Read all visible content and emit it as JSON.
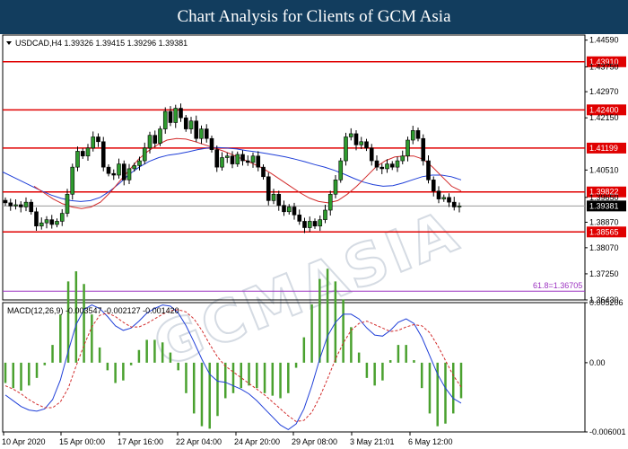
{
  "header": {
    "title": "Chart Analysis for Clients of GCM Asia"
  },
  "chart_data": {
    "type": "candlestick",
    "symbol_line": "USDCAD,H4  1.39326 1.39415 1.39296 1.39381",
    "price_axis": {
      "min": 1.3643,
      "max": 1.4475,
      "ticks": [
        "1.44590",
        "1.43750",
        "1.42970",
        "1.42150",
        "1.40510",
        "1.39650",
        "1.38870",
        "1.38070",
        "1.37250",
        "1.36430"
      ]
    },
    "time_axis": {
      "ticks": [
        "10 Apr 2020",
        "15 Apr 00:00",
        "17 Apr 16:00",
        "22 Apr 04:00",
        "24 Apr 20:00",
        "29 Apr 08:00",
        "3 May 21:01",
        "6 May 12:00"
      ]
    },
    "horizontal_levels": [
      {
        "label": "1.43910",
        "value": 1.4391,
        "color": "#e00000"
      },
      {
        "label": "1.42400",
        "value": 1.424,
        "color": "#e00000"
      },
      {
        "label": "1.41199",
        "value": 1.41199,
        "color": "#e00000"
      },
      {
        "label": "1.39822",
        "value": 1.39822,
        "color": "#e00000"
      },
      {
        "label": "1.38565",
        "value": 1.38565,
        "color": "#e00000"
      }
    ],
    "current_price": {
      "label": "1.39381",
      "value": 1.39381
    },
    "fib_level": {
      "text": "61.8=1.36705",
      "value": 1.36705,
      "color": "#9b30c0"
    },
    "closes": [
      1.3948,
      1.3938,
      1.3942,
      1.3935,
      1.395,
      1.392,
      1.3875,
      1.3885,
      1.3895,
      1.388,
      1.389,
      1.3915,
      1.3975,
      1.406,
      1.411,
      1.4095,
      1.412,
      1.4155,
      1.414,
      1.406,
      1.404,
      1.4035,
      1.407,
      1.402,
      1.4055,
      1.4065,
      1.408,
      1.412,
      1.416,
      1.4135,
      1.418,
      1.4235,
      1.42,
      1.4245,
      1.4215,
      1.418,
      1.4205,
      1.415,
      1.418,
      1.415,
      1.4115,
      1.406,
      1.409,
      1.4095,
      1.407,
      1.41,
      1.408,
      1.4075,
      1.4095,
      1.406,
      1.403,
      1.3955,
      1.3975,
      1.394,
      1.392,
      1.3935,
      1.391,
      1.389,
      1.387,
      1.389,
      1.3875,
      1.3895,
      1.3925,
      1.3975,
      1.402,
      1.408,
      1.4155,
      1.4165,
      1.413,
      1.414,
      1.412,
      1.408,
      1.406,
      1.4055,
      1.407,
      1.406,
      1.408,
      1.4095,
      1.4145,
      1.4175,
      1.415,
      1.408,
      1.402,
      1.3985,
      1.396,
      1.3965,
      1.395,
      1.3935,
      1.3938
    ],
    "ma_blue": [
      1.4045,
      1.403,
      1.4015,
      1.4,
      1.3985,
      1.3972,
      1.3962,
      1.3955,
      1.3952,
      1.3955,
      1.3965,
      1.3985,
      1.401,
      1.4038,
      1.406,
      1.4078,
      1.409,
      1.4098,
      1.4102,
      1.4108,
      1.4115,
      1.412,
      1.4122,
      1.412,
      1.4117,
      1.4112,
      1.4108,
      1.4103,
      1.4098,
      1.4092,
      1.4085,
      1.4077,
      1.4068,
      1.406,
      1.405,
      1.4038,
      1.4025,
      1.4013,
      1.4005,
      1.4,
      1.4002,
      1.401,
      1.402,
      1.403,
      1.4035,
      1.4035,
      1.403,
      1.402
    ],
    "ma_red": [
      1.4,
      1.398,
      1.396,
      1.3945,
      1.3935,
      1.393,
      1.3935,
      1.395,
      1.398,
      1.4015,
      1.405,
      1.4085,
      1.411,
      1.413,
      1.4145,
      1.415,
      1.4148,
      1.414,
      1.413,
      1.412,
      1.411,
      1.4098,
      1.4085,
      1.4072,
      1.4058,
      1.404,
      1.402,
      1.4,
      1.398,
      1.3963,
      1.3952,
      1.3948,
      1.3955,
      1.3975,
      1.4,
      1.403,
      1.406,
      1.408,
      1.4092,
      1.4095,
      1.4095,
      1.4085,
      1.406,
      1.403,
      1.4,
      1.3985
    ],
    "macd": {
      "label": "MACD(12,26,9) -0.003547 -0.002127 -0.001420",
      "axis": {
        "min": -0.006001,
        "max": 0.005206,
        "ticks": [
          "0.005206",
          "0.00",
          "-0.006001"
        ]
      },
      "macd_line": [
        -0.0028,
        -0.0033,
        -0.0038,
        -0.0041,
        -0.0042,
        -0.004,
        -0.0032,
        -0.0015,
        0.001,
        0.0033,
        0.0046,
        0.005,
        0.0047,
        0.004,
        0.0032,
        0.0028,
        0.003,
        0.0036,
        0.0043,
        0.0047,
        0.005,
        0.0049,
        0.0043,
        0.0032,
        0.0018,
        0.0003,
        -0.001,
        -0.0016,
        -0.0017,
        -0.002,
        -0.0023,
        -0.0027,
        -0.0033,
        -0.004,
        -0.0047,
        -0.0054,
        -0.0058,
        -0.0053,
        -0.004,
        -0.002,
        0.0003,
        0.0023,
        0.0035,
        0.0042,
        0.0042,
        0.0038,
        0.003,
        0.0024,
        0.0023,
        0.0028,
        0.0035,
        0.0038,
        0.0034,
        0.0022,
        0.0006,
        -0.001,
        -0.0022,
        -0.0031,
        -0.0035
      ],
      "signal_line": [
        -0.002,
        -0.0023,
        -0.0027,
        -0.0032,
        -0.0036,
        -0.0039,
        -0.0039,
        -0.0034,
        -0.0022,
        -0.0003,
        0.0015,
        0.0031,
        0.0041,
        0.0043,
        0.004,
        0.0035,
        0.0031,
        0.0031,
        0.0034,
        0.0038,
        0.0042,
        0.0045,
        0.0046,
        0.0044,
        0.0038,
        0.0028,
        0.0016,
        0.0005,
        -0.0003,
        -0.0008,
        -0.0013,
        -0.0018,
        -0.0023,
        -0.0028,
        -0.0034,
        -0.004,
        -0.0046,
        -0.0051,
        -0.005,
        -0.0043,
        -0.003,
        -0.0014,
        0.0003,
        0.0017,
        0.0028,
        0.0034,
        0.0036,
        0.0033,
        0.003,
        0.0027,
        0.0028,
        0.0031,
        0.0033,
        0.0032,
        0.0026,
        0.0015,
        0.0002,
        -0.0011,
        -0.0021
      ]
    }
  },
  "watermark": "GCMASIA"
}
